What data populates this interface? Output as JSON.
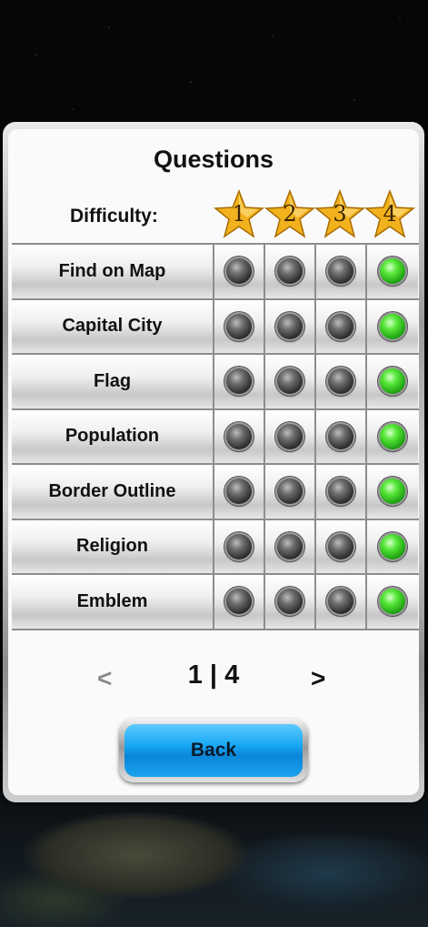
{
  "title": "Questions",
  "difficulty_label": "Difficulty:",
  "levels": [
    "1",
    "2",
    "3",
    "4"
  ],
  "categories": [
    {
      "label": "Find on Map",
      "selected_level": 4
    },
    {
      "label": "Capital City",
      "selected_level": 4
    },
    {
      "label": "Flag",
      "selected_level": 4
    },
    {
      "label": "Population",
      "selected_level": 4
    },
    {
      "label": "Border Outline",
      "selected_level": 4
    },
    {
      "label": "Religion",
      "selected_level": 4
    },
    {
      "label": "Emblem",
      "selected_level": 4
    }
  ],
  "pager": {
    "prev": "<",
    "text": "1 | 4",
    "next": ">"
  },
  "back_label": "Back",
  "colors": {
    "active": "#2bd61a",
    "inactive": "#3a3a3a",
    "button": "#18a8f4",
    "star": "#f2b21e"
  }
}
